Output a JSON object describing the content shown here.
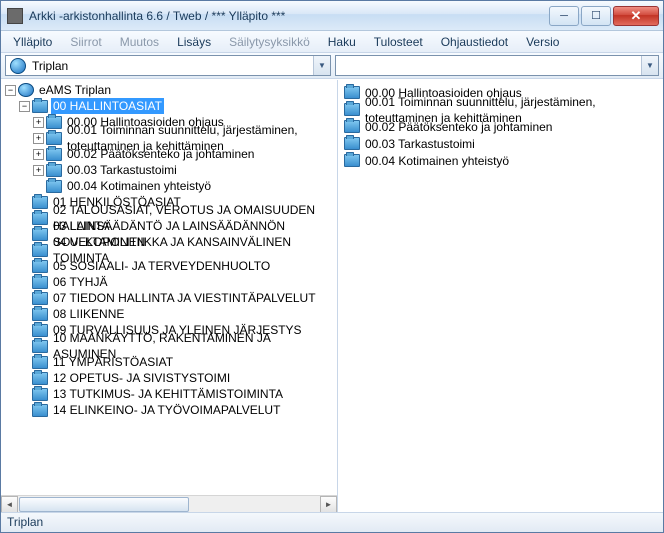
{
  "window": {
    "title": "Arkki -arkistonhallinta 6.6 / Tweb / *** Ylläpito ***"
  },
  "menu": {
    "items": [
      {
        "label": "Ylläpito",
        "enabled": true
      },
      {
        "label": "Siirrot",
        "enabled": false
      },
      {
        "label": "Muutos",
        "enabled": false
      },
      {
        "label": "Lisäys",
        "enabled": true
      },
      {
        "label": "Säilytysyksikkö",
        "enabled": false
      },
      {
        "label": "Haku",
        "enabled": true
      },
      {
        "label": "Tulosteet",
        "enabled": true
      },
      {
        "label": "Ohjaustiedot",
        "enabled": true
      },
      {
        "label": "Versio",
        "enabled": true
      }
    ]
  },
  "combo": {
    "left_value": "Triplan",
    "right_value": ""
  },
  "tree": {
    "root": "eAMS Triplan",
    "selected": "00 HALLINTOASIAT",
    "sel_children": [
      "00.00 Hallintoasioiden ohjaus",
      "00.01 Toiminnan suunnittelu, järjestäminen, toteuttaminen ja kehittäminen",
      "00.02 Päätöksenteko ja johtaminen",
      "00.03 Tarkastustoimi",
      "00.04 Kotimainen yhteistyö"
    ],
    "siblings": [
      "01 HENKILÖSTÖASIAT",
      "02 TALOUSASIAT, VEROTUS JA OMAISUUDEN HALLINTA",
      "03 LAINSÄÄDÄNTÖ JA LAINSÄÄDÄNNÖN SOVELTAMINEN",
      "04 ULKOPOLITIIKKA JA KANSAINVÄLINEN TOIMINTA",
      "05 SOSIAALI- JA TERVEYDENHUOLTO",
      "06 TYHJÄ",
      "07 TIEDON HALLINTA JA VIESTINTÄPALVELUT",
      "08 LIIKENNE",
      "09 TURVALLISUUS JA YLEINEN JÄRJESTYS",
      "10 MAANKÄYTTÖ, RAKENTAMINEN JA ASUMINEN",
      "11 YMPÄRISTÖASIAT",
      "12 OPETUS- JA SIVISTYSTOIMI",
      "13 TUTKIMUS- JA KEHITTÄMISTOIMINTA",
      "14 ELINKEINO- JA TYÖVOIMAPALVELUT"
    ]
  },
  "list": {
    "items": [
      "00.00 Hallintoasioiden ohjaus",
      "00.01 Toiminnan suunnittelu, järjestäminen, toteuttaminen ja kehittäminen",
      "00.02 Päätöksenteko ja johtaminen",
      "00.03 Tarkastustoimi",
      "00.04 Kotimainen yhteistyö"
    ]
  },
  "status": {
    "text": "Triplan"
  }
}
